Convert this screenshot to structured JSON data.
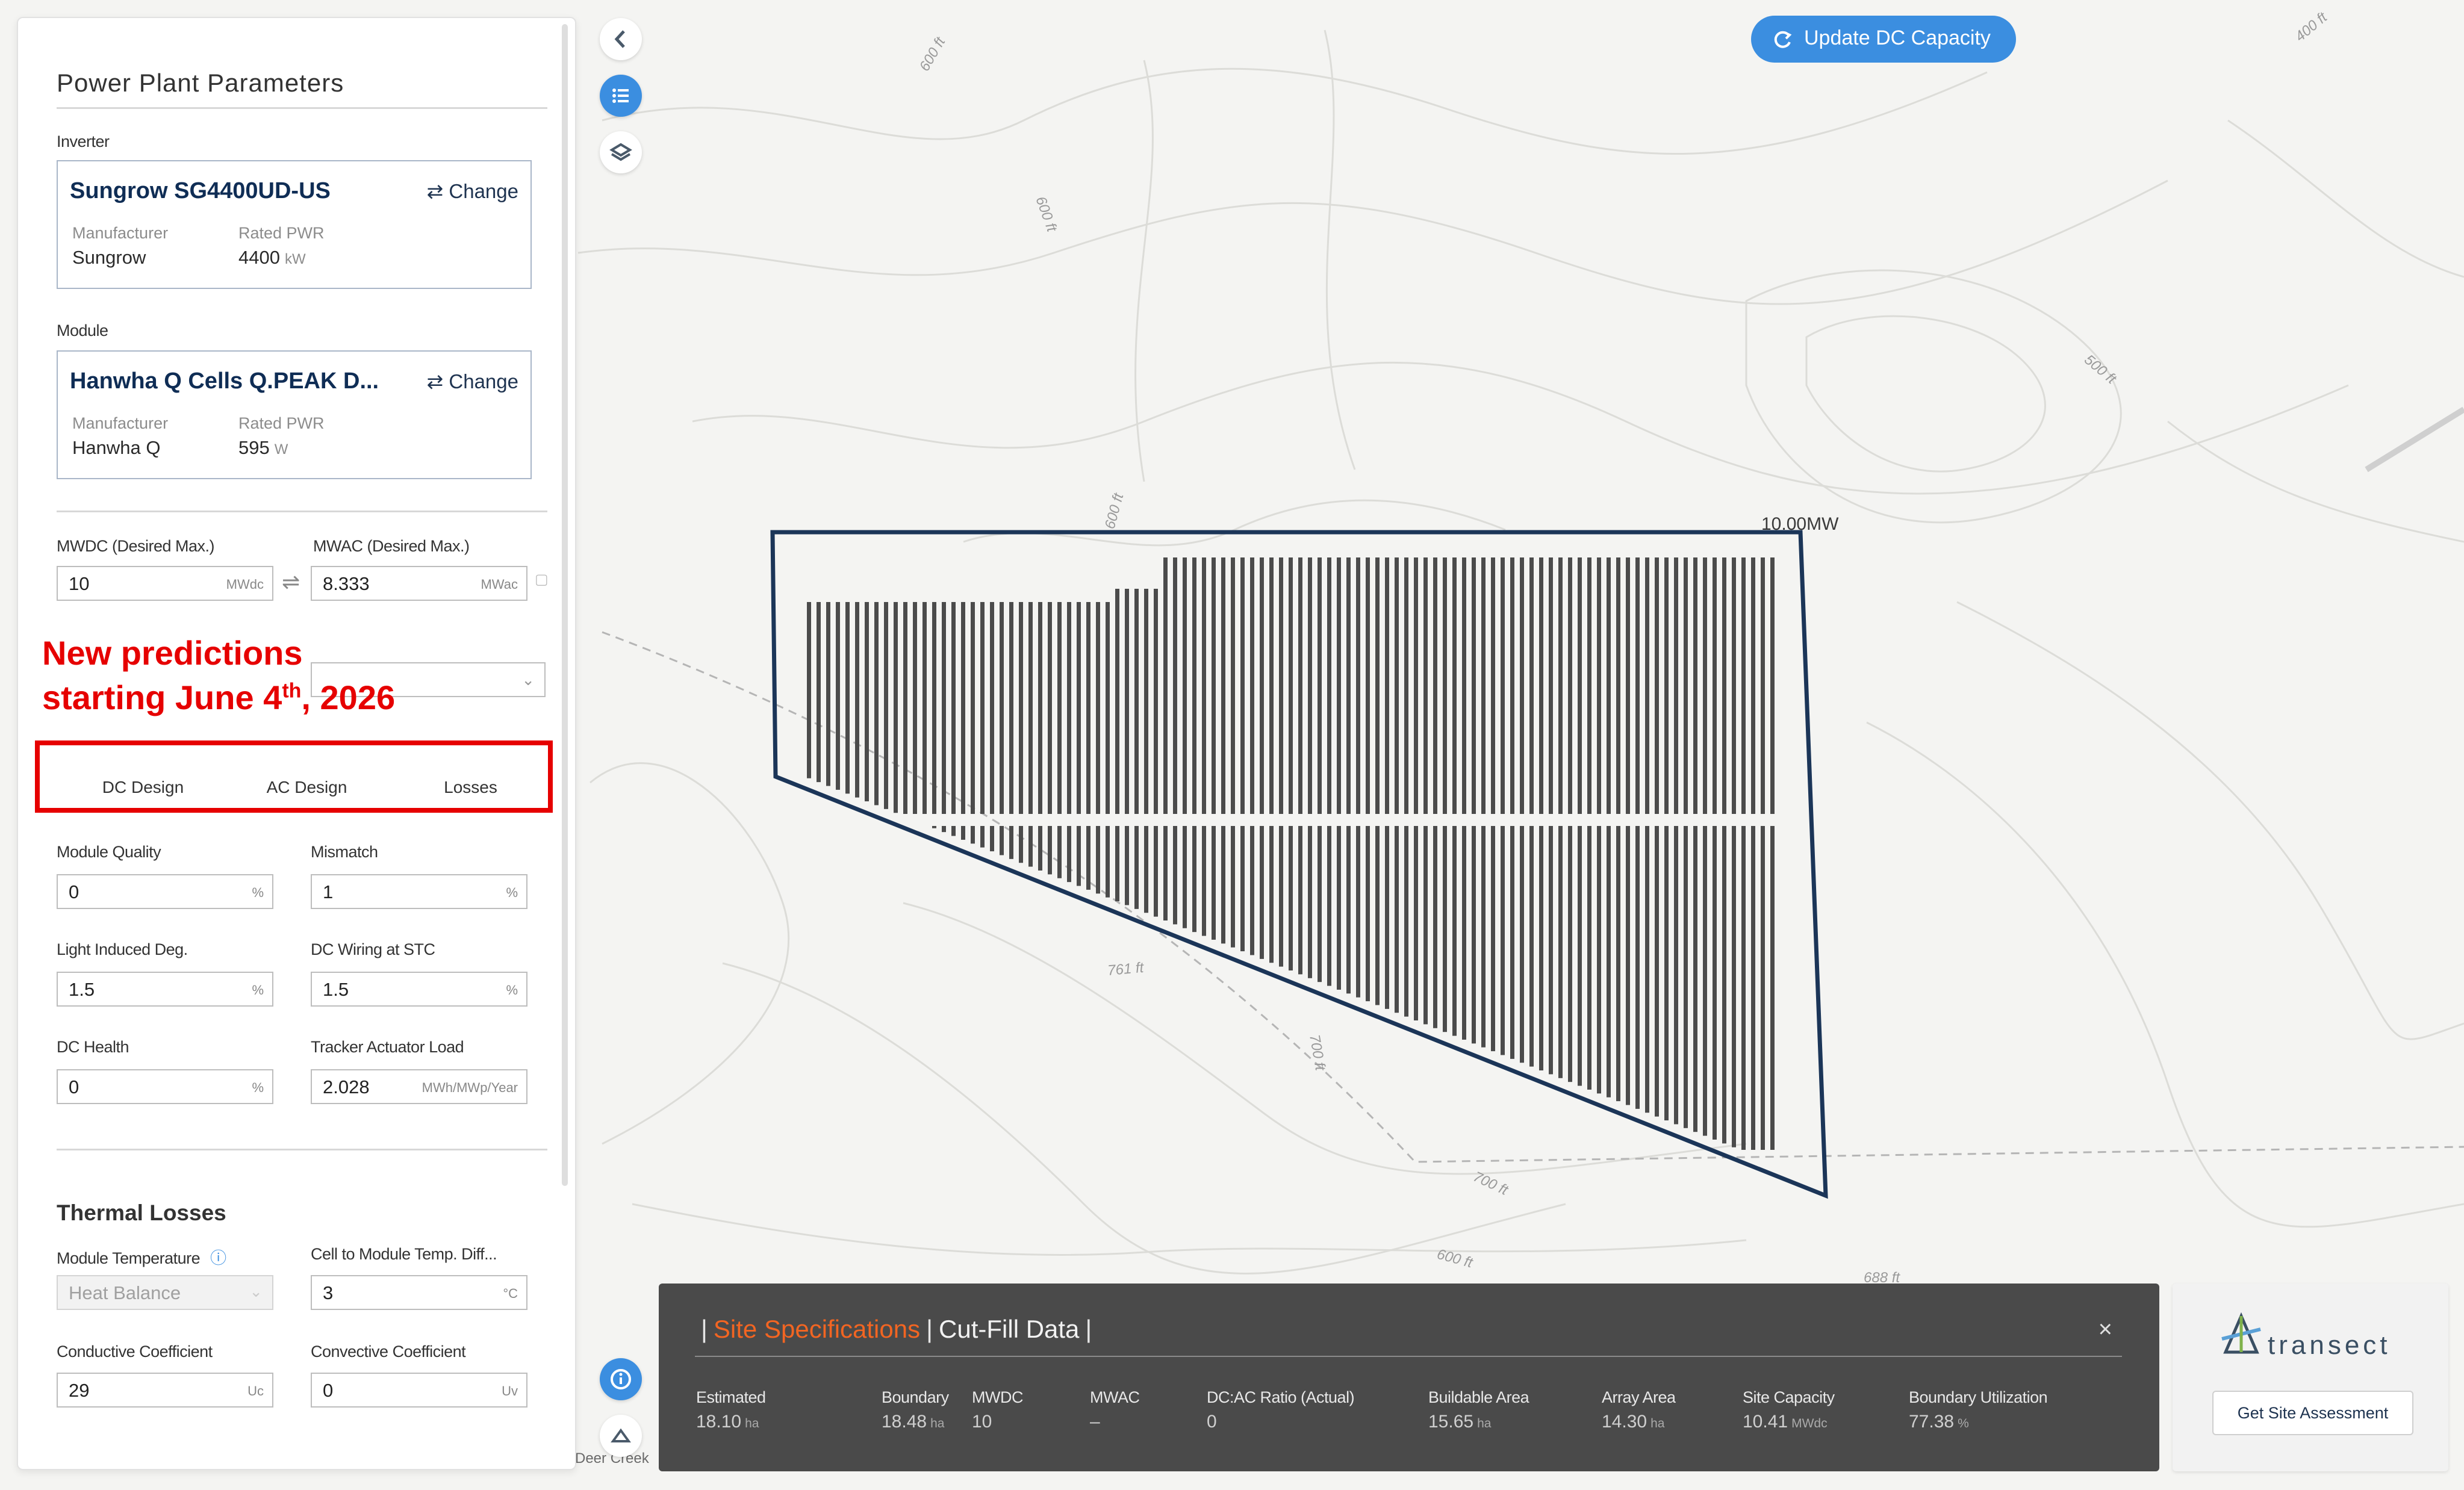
{
  "panel": {
    "title": "Power Plant Parameters",
    "inverter": {
      "section_label": "Inverter",
      "name": "Sungrow SG4400UD-US",
      "change_label": "Change",
      "manufacturer_label": "Manufacturer",
      "manufacturer": "Sungrow",
      "rated_label": "Rated PWR",
      "rated_value": "4400",
      "rated_unit": "kW"
    },
    "module": {
      "section_label": "Module",
      "name": "Hanwha Q Cells Q.PEAK D...",
      "change_label": "Change",
      "manufacturer_label": "Manufacturer",
      "manufacturer": "Hanwha Q",
      "rated_label": "Rated PWR",
      "rated_value": "595",
      "rated_unit": "W"
    },
    "mwdc": {
      "label": "MWDC (Desired Max.)",
      "value": "10",
      "unit": "MWdc"
    },
    "mwac": {
      "label": "MWAC (Desired Max.)",
      "value": "8.333",
      "unit": "MWac"
    },
    "tabs": [
      {
        "label": "DC Design"
      },
      {
        "label": "AC Design"
      },
      {
        "label": "Losses"
      }
    ],
    "losses": {
      "module_quality": {
        "label": "Module Quality",
        "value": "0",
        "unit": "%"
      },
      "mismatch": {
        "label": "Mismatch",
        "value": "1",
        "unit": "%"
      },
      "lid": {
        "label": "Light Induced Deg.",
        "value": "1.5",
        "unit": "%"
      },
      "dc_wiring": {
        "label": "DC Wiring at STC",
        "value": "1.5",
        "unit": "%"
      },
      "dc_health": {
        "label": "DC Health",
        "value": "0",
        "unit": "%"
      },
      "tracker_load": {
        "label": "Tracker Actuator Load",
        "value": "2.028",
        "unit": "MWh/MWp/Year"
      }
    },
    "thermal": {
      "title": "Thermal Losses",
      "module_temp": {
        "label": "Module Temperature",
        "value": "Heat Balance"
      },
      "cell_to_module": {
        "label": "Cell to Module Temp. Diff...",
        "value": "3",
        "unit": "°C"
      },
      "conductive": {
        "label": "Conductive Coefficient",
        "value": "29",
        "unit": "Uc"
      },
      "convective": {
        "label": "Convective Coefficient",
        "value": "0",
        "unit": "Uv"
      }
    }
  },
  "annotation": {
    "line1": "New predictions",
    "line2_prefix": "starting June 4",
    "line2_sup": "th",
    "line2_suffix": ", 2026"
  },
  "map": {
    "update_button": "Update DC Capacity",
    "capacity_label": "10.00MW",
    "contour_labels": [
      "600 ft",
      "600 ft",
      "600 ft",
      "500 ft",
      "400 ft",
      "761 ft",
      "700 ft",
      "700 ft",
      "600 ft",
      "688 ft"
    ],
    "road_label": "Deer Creek"
  },
  "specs": {
    "tab_active": "Site Specifications",
    "tab_other": "Cut-Fill Data",
    "close": "×",
    "stats": [
      {
        "label": "Estimated",
        "value": "18.10",
        "unit": "ha"
      },
      {
        "label": "Boundary",
        "value": "18.48",
        "unit": "ha"
      },
      {
        "label": "MWDC",
        "value": "10",
        "unit": ""
      },
      {
        "label": "MWAC",
        "value": "–",
        "unit": ""
      },
      {
        "label": "DC:AC Ratio (Actual)",
        "value": "0",
        "unit": ""
      },
      {
        "label": "Buildable Area",
        "value": "15.65",
        "unit": "ha"
      },
      {
        "label": "Array Area",
        "value": "14.30",
        "unit": "ha"
      },
      {
        "label": "Site Capacity",
        "value": "10.41",
        "unit": "MWdc"
      },
      {
        "label": "Boundary Utilization",
        "value": "77.38",
        "unit": "%"
      }
    ]
  },
  "brand": {
    "name": "transect",
    "button": "Get Site Assessment"
  },
  "colors": {
    "accent_orange": "#f26522",
    "button_blue": "#3b8ee0",
    "boundary_navy": "#1b3558",
    "annotation_red": "#e60000"
  }
}
